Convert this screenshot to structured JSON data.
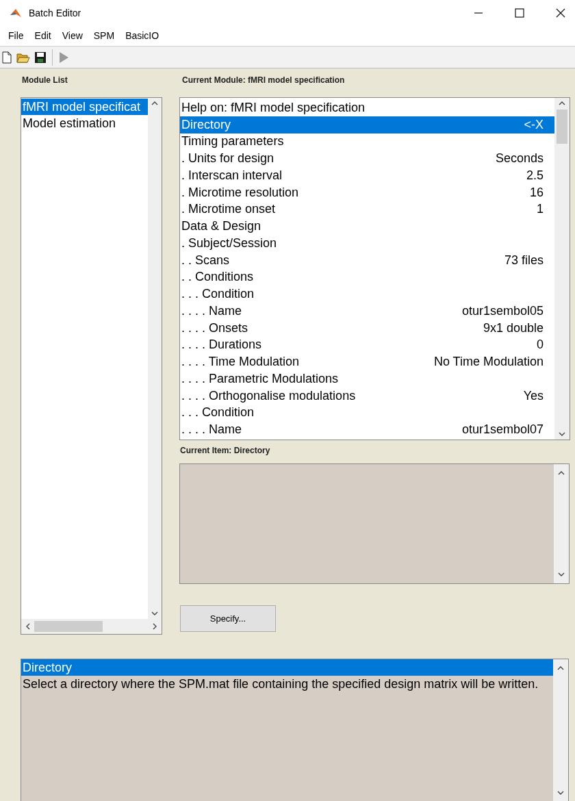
{
  "window": {
    "title": "Batch Editor"
  },
  "menu": [
    "File",
    "Edit",
    "View",
    "SPM",
    "BasicIO"
  ],
  "module_list": {
    "title": "Module List",
    "items": [
      {
        "label": "fMRI model specificat",
        "selected": true
      },
      {
        "label": "Model estimation",
        "selected": false
      }
    ]
  },
  "current_module": {
    "title": "Current Module: fMRI model specification",
    "items": [
      {
        "label": "Help on: fMRI model specification",
        "selected": false
      },
      {
        "label": "Directory",
        "value": "<-X",
        "selected": true
      },
      {
        "label": "Timing parameters",
        "selected": false
      },
      {
        "label": ". Units for design",
        "value": "Seconds",
        "selected": false
      },
      {
        "label": ". Interscan interval",
        "value": "2.5",
        "selected": false
      },
      {
        "label": ". Microtime resolution",
        "value": "16",
        "selected": false
      },
      {
        "label": ". Microtime onset",
        "value": "1",
        "selected": false
      },
      {
        "label": "Data & Design",
        "selected": false
      },
      {
        "label": ". Subject/Session",
        "selected": false
      },
      {
        "label": ". . Scans",
        "value": "73 files",
        "selected": false
      },
      {
        "label": ". . Conditions",
        "selected": false
      },
      {
        "label": ". . . Condition",
        "selected": false
      },
      {
        "label": ". . . . Name",
        "value": "otur1sembol05",
        "selected": false
      },
      {
        "label": ". . . . Onsets",
        "value": "9x1 double",
        "selected": false
      },
      {
        "label": ". . . . Durations",
        "value": "0",
        "selected": false
      },
      {
        "label": ". . . . Time Modulation",
        "value": "No Time Modulation",
        "selected": false
      },
      {
        "label": ". . . . Parametric Modulations",
        "selected": false
      },
      {
        "label": ". . . . Orthogonalise modulations",
        "value": "Yes",
        "selected": false
      },
      {
        "label": ". . . Condition",
        "selected": false
      },
      {
        "label": ". . . . Name",
        "value": "otur1sembol07",
        "selected": false
      }
    ]
  },
  "current_item": {
    "title": "Current Item: Directory"
  },
  "specify_button": "Specify...",
  "help": {
    "heading": "Directory",
    "text": "Select a directory where the SPM.mat file containing the specified design matrix will be written."
  }
}
